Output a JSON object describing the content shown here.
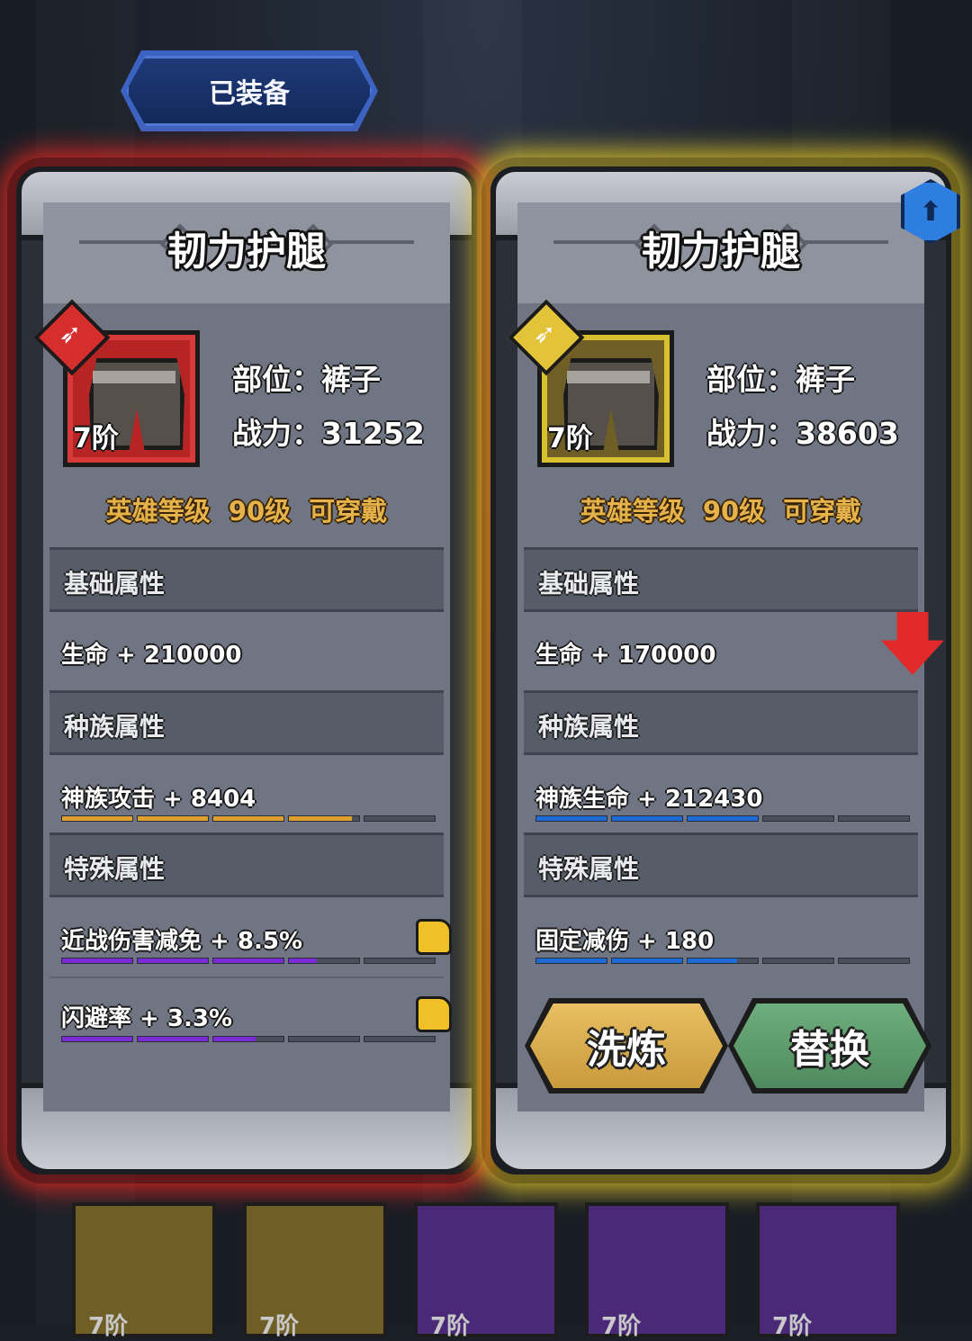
{
  "equipped_label": "已装备",
  "cards": [
    {
      "title": "韧力护腿",
      "tier": "7阶",
      "slot_line": "部位：裤子",
      "power_line": "战力：31252",
      "requirement": "英雄等级  90级  可穿戴",
      "sections": {
        "base": "基础属性",
        "race": "种族属性",
        "special": "特殊属性"
      },
      "base_stat": "生命 + 210000",
      "race_stat": "神族攻击 + 8404",
      "race_stat_fill": 0.78,
      "special_stats": [
        {
          "text": "近战伤害减免 + 8.5%",
          "fill": 0.68
        },
        {
          "text": "闪避率 + 3.3%",
          "fill": 0.52
        }
      ],
      "accent": "#e02a22",
      "race_bar_color": "#e0a030",
      "special_bar_color": "#7a2bd6"
    },
    {
      "title": "韧力护腿",
      "tier": "7阶",
      "slot_line": "部位：裤子",
      "power_line": "战力：38603",
      "requirement": "英雄等级  90级  可穿戴",
      "sections": {
        "base": "基础属性",
        "race": "种族属性",
        "special": "特殊属性"
      },
      "base_stat": "生命 + 170000",
      "race_stat": "神族生命 + 212430",
      "race_stat_fill": 0.6,
      "special_stats": [
        {
          "text": "固定减伤 + 180",
          "fill": 0.54
        }
      ],
      "buttons": {
        "refine": "洗炼",
        "replace": "替换"
      },
      "accent": "#e8cc2e",
      "race_bar_color": "#1e6ad6",
      "special_bar_color": "#1e6ad6"
    }
  ],
  "inventory_tier_labels": [
    "7阶",
    "7阶",
    "7阶",
    "7阶",
    "7阶"
  ]
}
